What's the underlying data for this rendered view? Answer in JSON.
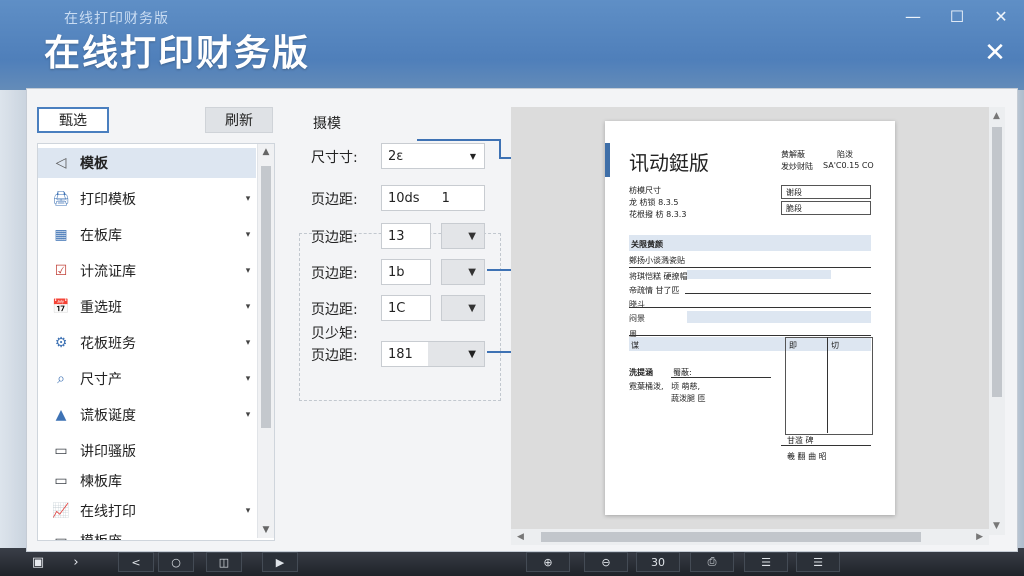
{
  "window": {
    "small_title": "在线打印财务版",
    "title": "在线打印财务版",
    "controls": [
      "—",
      "☐",
      "✕"
    ],
    "close_big": "✕"
  },
  "left_panel": {
    "select_button": "甄选",
    "refresh_button": "刷新",
    "items": [
      {
        "label": "模板",
        "icon": "template-icon",
        "chevron": false,
        "selected": true
      },
      {
        "label": "打印模板",
        "icon": "print-template-icon",
        "chevron": true
      },
      {
        "label": "在板库",
        "icon": "grid-icon",
        "chevron": true
      },
      {
        "label": "计流证库",
        "icon": "checkbox-icon",
        "chevron": true
      },
      {
        "label": "重选班",
        "icon": "calendar-icon",
        "chevron": true
      },
      {
        "label": "花板班务",
        "icon": "settings-icon",
        "chevron": true
      },
      {
        "label": "尺寸产",
        "icon": "search-icon",
        "chevron": true
      },
      {
        "label": "谎板诞度",
        "icon": "warning-icon",
        "chevron": true
      },
      {
        "label": "讲印骚版",
        "icon": "folder-icon",
        "chevron": false
      },
      {
        "label": "楝板库",
        "icon": "folder-icon",
        "chevron": false
      },
      {
        "label": "在线打印",
        "icon": "chart-icon",
        "chevron": true
      },
      {
        "label": "模板庞",
        "icon": "folder-icon",
        "chevron": false
      }
    ]
  },
  "settings": {
    "title": "摄模",
    "rows": [
      {
        "label": "尺寸寸:",
        "value": "2ε"
      },
      {
        "label": "页边距:",
        "value": "10ds",
        "value2": "1"
      },
      {
        "label": "页边距:",
        "value": "13"
      },
      {
        "label": "页边距:",
        "value": "1b"
      },
      {
        "label": "页边距:",
        "value": "1C"
      },
      {
        "label": "页边距:",
        "value": "181",
        "pre_label": "贝少矩:"
      }
    ]
  },
  "document": {
    "title": "讯动鋌版",
    "header_right": [
      "黄解蔽",
      "陷泼"
    ],
    "header_right2": [
      "发炒财陆",
      "SA'C0.15 CO"
    ],
    "subtitle_lines": [
      "枋模尺寸",
      "龙 枋锁 8.3.5",
      "花根撥 枋 8.3.3"
    ],
    "right_boxes": [
      "谢段",
      "脆段"
    ],
    "section_title": "关限黄颜",
    "section_rows": [
      "鄭扬小谈溅瓷贴",
      "将琪恺糕 硬撩帽",
      "帝疏情 甘了匹",
      "晓斗",
      "闷景",
      "周"
    ],
    "table_head": [
      "谋",
      "即",
      "切"
    ],
    "footer_label": "洗提涵",
    "footer_value": "蜀蔽:",
    "footer_lines": [
      "霓葉桶泼,",
      "顷 萌慈,",
      "蔬泼腿 匝"
    ],
    "signatures": [
      "甘滥 碑",
      "羲 翻 曲 昭"
    ]
  },
  "taskbar": {
    "keys": [
      "<",
      "○",
      "◫",
      "▶",
      "⊕",
      "⊖",
      "30",
      "⎙",
      "☰",
      "☰"
    ]
  }
}
